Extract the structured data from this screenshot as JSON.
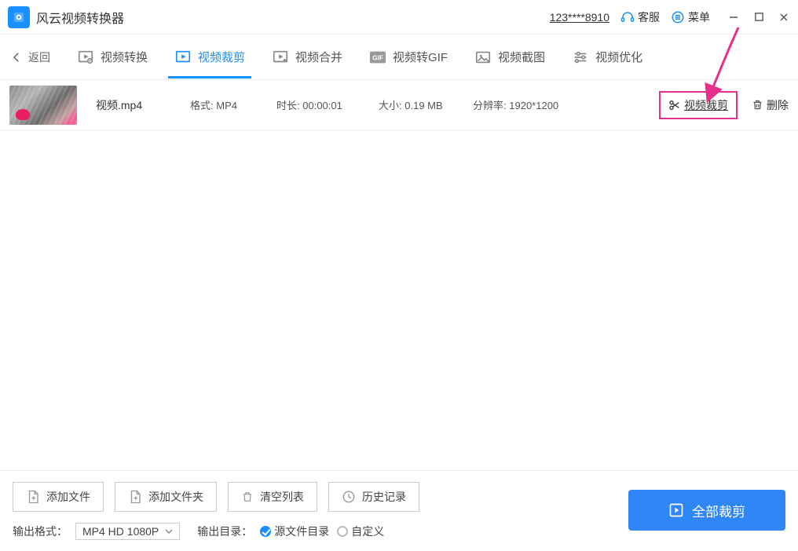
{
  "app": {
    "title": "风云视频转换器"
  },
  "titlebar": {
    "user_id": "123****8910",
    "support": "客服",
    "menu": "菜单"
  },
  "tabs": {
    "back": "返回",
    "convert": "视频转换",
    "crop": "视频裁剪",
    "merge": "视频合并",
    "togif": "视频转GIF",
    "screenshot": "视频截图",
    "optimize": "视频优化"
  },
  "file": {
    "name": "视频.mp4",
    "format_label": "格式:",
    "format": "MP4",
    "duration_label": "时长:",
    "duration": "00:00:01",
    "size_label": "大小:",
    "size": "0.19 MB",
    "resolution_label": "分辨率:",
    "resolution": "1920*1200",
    "crop_action": "视频裁剪",
    "delete_action": "删除"
  },
  "bottom": {
    "add_file": "添加文件",
    "add_folder": "添加文件夹",
    "clear_list": "清空列表",
    "history": "历史记录",
    "out_format_label": "输出格式：",
    "out_format_value": "MP4 HD 1080P",
    "out_dir_label": "输出目录：",
    "radio_source": "源文件目录",
    "radio_custom": "自定义",
    "primary": "全部裁剪"
  }
}
